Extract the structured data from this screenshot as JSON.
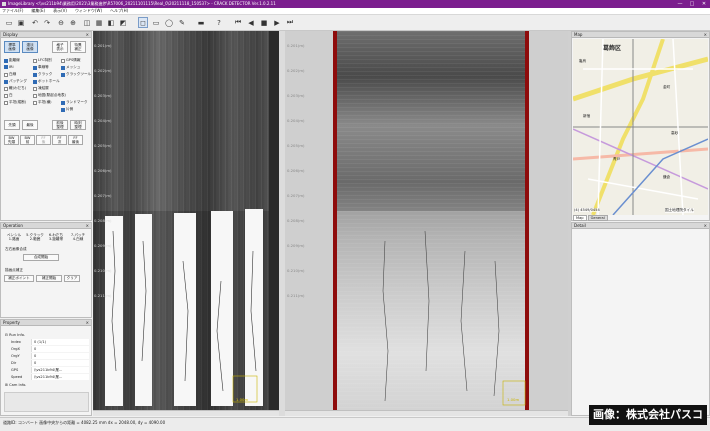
{
  "window": {
    "title": "ImageLibrary <\\\\vs211b94\\業務用\\2021\\3業務進捗\\R57006_20211101115\\Real_0\\20211118_150537> - CRACK DETECTOR Ver.1.0.2.11",
    "minimize": "—",
    "maximize": "□",
    "close": "✕"
  },
  "menu": [
    "ファイル(F)",
    "編集(E)",
    "表示(V)",
    "ウィンドウ(W)",
    "ヘルプ(H)"
  ],
  "toolbar_icons": [
    "folder-icon",
    "save-icon",
    "undo-icon",
    "redo-icon",
    "zoom-out-icon",
    "zoom-in-icon",
    "fit-icon",
    "grid-icon",
    "select-icon",
    "rect-icon",
    "circle-icon",
    "pen-icon",
    "ruler-icon",
    "help-icon",
    "first-icon",
    "prev-icon",
    "stop-icon",
    "play-icon",
    "last-icon"
  ],
  "display_panel": {
    "title": "Display",
    "mode_buttons": [
      "標準\n画像",
      "濃淡\n画像",
      "格子\n表示",
      "特異\n補正"
    ],
    "checks": [
      {
        "label": "距離線",
        "on": true
      },
      {
        "label": "LFC特別",
        "on": false
      },
      {
        "label": "GPS情報",
        "on": false
      },
      {
        "label": "IRI",
        "on": true
      },
      {
        "label": "車線等",
        "on": true
      },
      {
        "label": "メッシュ",
        "on": true
      },
      {
        "label": "白線",
        "on": false
      },
      {
        "label": "クラック",
        "on": true
      },
      {
        "label": "クラックツール",
        "on": true
      },
      {
        "label": "パッチング",
        "on": true
      },
      {
        "label": "ポットホール",
        "on": true
      },
      {
        "label": "轍(わだち)",
        "on": false
      },
      {
        "label": "凍結層",
        "on": false
      },
      {
        "label": "白",
        "on": false
      },
      {
        "label": "地図(駅起点地表)",
        "on": false
      },
      {
        "label": "平坦(縦断)",
        "on": false
      },
      {
        "label": "平坦(横)",
        "on": false
      },
      {
        "label": "ランドマーク",
        "on": true
      },
      {
        "label": "片側",
        "on": true
      }
    ],
    "row_buttons_1": [
      "先頭",
      "最後",
      "前後\n整理",
      "時刻\n整理"
    ],
    "row_buttons_2": [
      "BW\n先頭",
      "BW\n前",
      "FF\n後",
      "FF\n次",
      "FF\n最後"
    ]
  },
  "operation_panel": {
    "title": "Operation",
    "categories": [
      "ペンシル\n1.路面",
      "5.クラック\n2.範囲",
      "6.わだち\n3.距離帯",
      "7.パッチ\n4.白線"
    ],
    "section_title": "左右画像合成",
    "compose_button": "合成開始",
    "correction_title": "描画点補正",
    "correction_buttons": [
      "補正ポイント",
      "補正開始",
      "クリア"
    ]
  },
  "property_panel": {
    "title": "Property",
    "group_run": "Run Info.",
    "rows": [
      {
        "key": "Index",
        "value": "0 (1/1)"
      },
      {
        "key": "OrgX",
        "value": "0"
      },
      {
        "key": "OrgY",
        "value": "0"
      },
      {
        "key": "Dir",
        "value": "0"
      },
      {
        "key": "GPS",
        "value": "\\\\vs211b94\\業..."
      },
      {
        "key": "Speed",
        "value": "\\\\vs211b94\\業..."
      }
    ],
    "group_cam": "Cam Info."
  },
  "left_road": {
    "ticks": [
      "0.201(m)",
      "0.202(m)",
      "0.203(m)",
      "0.204(m)",
      "0.205(m)",
      "0.206(m)",
      "0.207(m)",
      "0.208(m)",
      "0.209(m)",
      "0.210(m)",
      "0.211(m)"
    ],
    "scale_label": "1.00m"
  },
  "right_road": {
    "ticks": [
      "0.201(m)",
      "0.202(m)",
      "0.203(m)",
      "0.204(m)",
      "0.205(m)",
      "0.206(m)",
      "0.207(m)",
      "0.208(m)",
      "0.209(m)",
      "0.210(m)",
      "0.211(m)"
    ],
    "scale_label": "1.00m"
  },
  "map_panel": {
    "title": "Map",
    "district": "葛飾区",
    "labels": [
      "亀有",
      "金町",
      "新宿",
      "高砂",
      "青戸",
      "鎌倉"
    ],
    "coords": "(4) 4549/0454",
    "scale": "国土地理院タイル",
    "tabs": [
      "Map",
      "General"
    ]
  },
  "detail_panel": {
    "title": "Detail"
  },
  "status": {
    "text": "道路ID: コンバート   画像中央からの距離 = 4082.25 mm  dx = 2048.00, dy = 4090.00"
  },
  "credit": "画像：株式会社パスコ",
  "colors": {
    "titlebar": "#7b1e8e",
    "accent": "#2f6bb5",
    "red_frame": "#8e0c0c"
  }
}
